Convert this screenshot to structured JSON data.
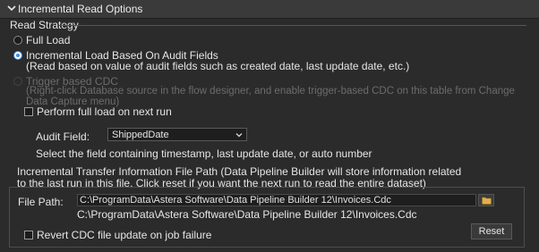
{
  "panel": {
    "title": "Incremental Read Options"
  },
  "read_strategy": {
    "legend": "Read Strategy",
    "options": [
      {
        "label": "Full Load",
        "description": "",
        "selected": false,
        "enabled": true
      },
      {
        "label": "Incremental Load Based On Audit Fields",
        "description": "(Read based on value of audit fields such as created date, last update date, etc.)",
        "selected": true,
        "enabled": true
      },
      {
        "label": "Trigger based CDC",
        "description": "(Right-click Database source in the flow designer, and enable trigger-based CDC on this table from Change Data Capture menu)",
        "selected": false,
        "enabled": false
      }
    ],
    "full_load_next_run": {
      "label": "Perform full load on next run",
      "checked": false
    },
    "audit_field": {
      "label": "Audit Field:",
      "value": "ShippedDate",
      "hint": "Select the field containing timestamp, last update date, or auto number"
    }
  },
  "transfer_info": {
    "legend_line1": "Incremental Transfer Information File Path (Data Pipeline Builder will store information related",
    "legend_line2": "to the last run in this file. Click reset if you want the next run to read the entire dataset)",
    "file_path": {
      "label": "File Path:",
      "value": "C:\\ProgramData\\Astera Software\\Data Pipeline Builder 12\\Invoices.Cdc",
      "echo": "C:\\ProgramData\\Astera Software\\Data Pipeline Builder 12\\Invoices.Cdc"
    },
    "revert_checkbox": {
      "label": "Revert CDC file update on job failure",
      "checked": false
    },
    "reset_button": "Reset"
  },
  "colors": {
    "accent": "#3a8ee6",
    "background": "#2b2b2b"
  },
  "icons": {
    "collapse": "chevron-down-icon",
    "browse": "folder-icon",
    "dropdown": "chevron-down-icon"
  }
}
